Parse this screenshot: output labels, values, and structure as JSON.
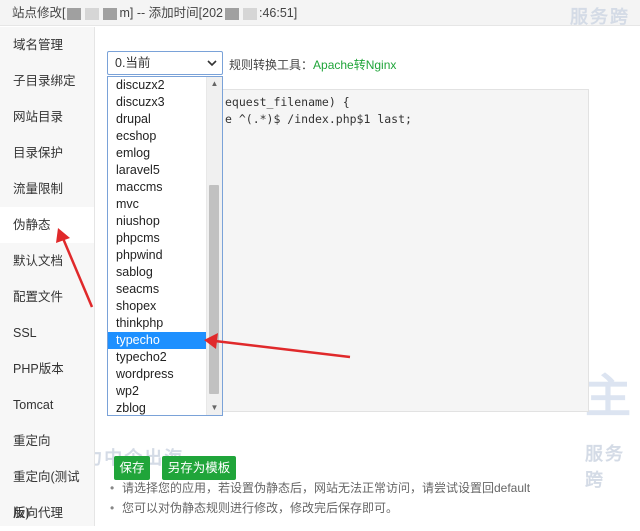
{
  "titlebar": {
    "prefix": "站点修改[",
    "mid": "m] -- 添加时间[202",
    "suffix": ":46:51]"
  },
  "watermark": {
    "small_top": "服务跨",
    "brand": "主机侦探",
    "slogan": "服务跨境电商 助力中企出海",
    "slogan_bottom": "电商 助力中企出海",
    "small_bottom": "服务跨",
    "right_brand": "主"
  },
  "sidebar": {
    "items": [
      {
        "label": "域名管理"
      },
      {
        "label": "子目录绑定"
      },
      {
        "label": "网站目录"
      },
      {
        "label": "目录保护"
      },
      {
        "label": "流量限制"
      },
      {
        "label": "伪静态"
      },
      {
        "label": "默认文档"
      },
      {
        "label": "配置文件"
      },
      {
        "label": "SSL"
      },
      {
        "label": "PHP版本"
      },
      {
        "label": "Tomcat"
      },
      {
        "label": "重定向"
      },
      {
        "label": "重定向(测试版)"
      },
      {
        "label": "反向代理"
      }
    ]
  },
  "rewrite": {
    "select_value": "0.当前",
    "convert_label": "规则转换工具：",
    "convert_link": "Apache转Nginx",
    "code_line1": "equest_filename) {",
    "code_line2": "e ^(.*)$ /index.php$1 last;"
  },
  "dropdown": {
    "options": [
      "discuzx2",
      "discuzx3",
      "drupal",
      "ecshop",
      "emlog",
      "laravel5",
      "maccms",
      "mvc",
      "niushop",
      "phpcms",
      "phpwind",
      "sablog",
      "seacms",
      "shopex",
      "thinkphp",
      "typecho",
      "typecho2",
      "wordpress",
      "wp2",
      "zblog"
    ],
    "selected": "typecho"
  },
  "buttons": {
    "save": "保存",
    "save_template": "另存为模板"
  },
  "tips": [
    "请选择您的应用，若设置伪静态后，网站无法正常访问，请尝试设置回default",
    "您可以对伪静态规则进行修改，修改完后保存即可。"
  ],
  "colors": {
    "accent": "#20a53a",
    "highlight": "#1e90ff",
    "arrow": "#e0292b"
  }
}
